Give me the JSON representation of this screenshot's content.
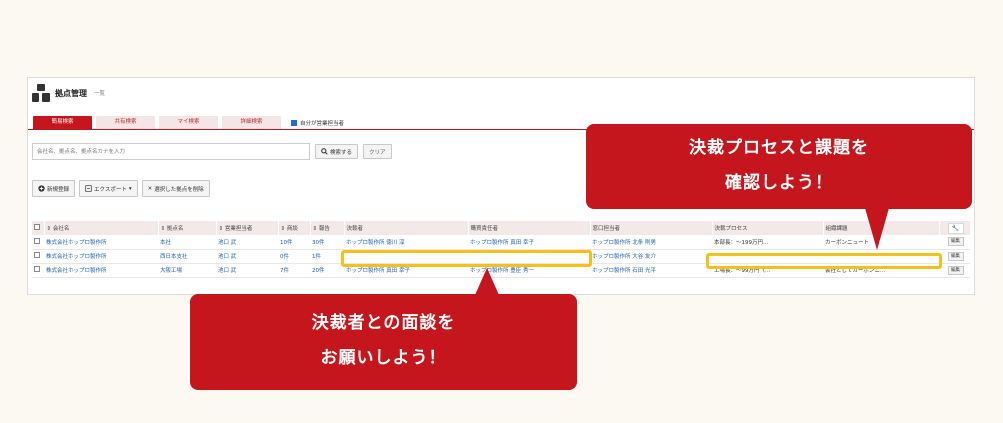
{
  "header": {
    "title": "拠点管理",
    "subtitle": "一覧"
  },
  "tabs": [
    {
      "label": "簡易検索",
      "active": true
    },
    {
      "label": "共有検索",
      "active": false
    },
    {
      "label": "マイ検索",
      "active": false
    },
    {
      "label": "詳細検索",
      "active": false
    }
  ],
  "filter": {
    "my_sales_label": "自分が営業担当者",
    "checked": true
  },
  "search": {
    "placeholder": "会社名、拠点名、拠点名カナを入力",
    "button": "検索する",
    "clear": "クリア"
  },
  "actions": {
    "new": "新規登録",
    "export": "エクスポート",
    "delete": "選択した拠点を削除"
  },
  "table": {
    "headers": [
      "会社名",
      "拠点名",
      "営業担当者",
      "商談",
      "報告",
      "決裁者",
      "購買責任者",
      "窓口担当者",
      "決裁プロセス",
      "組織課題"
    ],
    "rows": [
      [
        "株式会社ホップロ製作所",
        "本社",
        "池口 武",
        "10件",
        "30件",
        "ホップロ製作所 徳川 淳",
        "ホップロ製作所 真田 幸子",
        "ホップロ製作所 北条 則男",
        "本部長：〜199万円…",
        "カーボンニュート"
      ],
      [
        "株式会社ホップロ製作所",
        "西日本支社",
        "池口 武",
        "0件",
        "1件",
        "",
        "",
        "ホップロ製作所 大谷 友介",
        "",
        ""
      ],
      [
        "株式会社ホップロ製作所",
        "大阪工場",
        "池口 武",
        "7件",
        "20件",
        "ホップロ製作所 真田 幸子",
        "ホップロ製作所 豊臣 秀一",
        "ホップロ製作所 石田 光平",
        "工場長：〜99万円（…",
        "会社としてカーボンニ…"
      ]
    ],
    "edit_label": "編集"
  },
  "callouts": {
    "right": {
      "line1": "決裁プロセスと課題を",
      "line2": "確認しよう！"
    },
    "left": {
      "line1": "決裁者との面談を",
      "line2": "お願いしよう！"
    }
  },
  "colors": {
    "brand_red": "#c4161c",
    "highlight": "#f6c018",
    "link_blue": "#1c5fb8",
    "background": "#fcf8f2"
  }
}
